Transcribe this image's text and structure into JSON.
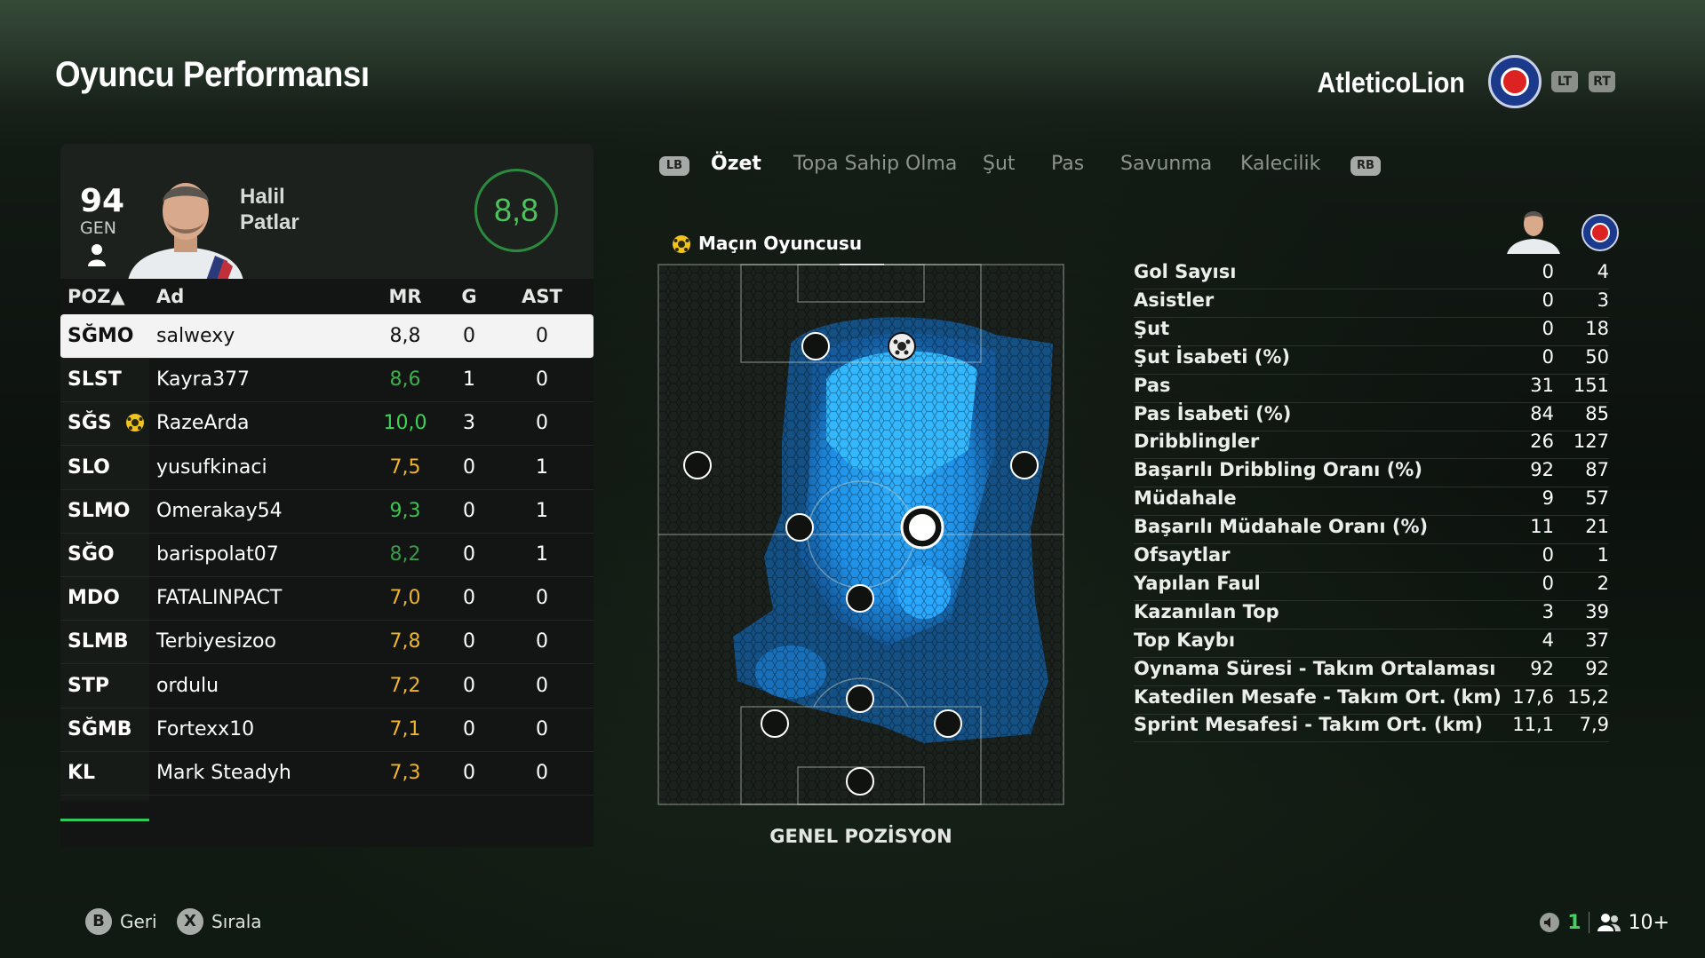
{
  "header": {
    "title": "Oyuncu Performansı",
    "club_name": "AtleticoLion",
    "lt_label": "LT",
    "rt_label": "RT"
  },
  "player_card": {
    "overall": "94",
    "overall_label": "GEN",
    "first_name": "Halil",
    "last_name": "Patlar",
    "match_rating": "8,8"
  },
  "table": {
    "headers": {
      "pos": "POZ▲",
      "name": "Ad",
      "mr": "MR",
      "g": "G",
      "ast": "AST"
    },
    "rows": [
      {
        "pos": "SĞMO",
        "name": "salwexy",
        "mr": "8,8",
        "g": "0",
        "ast": "0",
        "mr_color": "#111111",
        "selected": true,
        "motm": false
      },
      {
        "pos": "SLST",
        "name": "Kayra377",
        "mr": "8,6",
        "g": "1",
        "ast": "0",
        "mr_color": "#3fae4f",
        "selected": false,
        "motm": false
      },
      {
        "pos": "SĞS",
        "name": "RazeArda",
        "mr": "10,0",
        "g": "3",
        "ast": "0",
        "mr_color": "#3fd256",
        "selected": false,
        "motm": true
      },
      {
        "pos": "SLO",
        "name": "yusufkinaci",
        "mr": "7,5",
        "g": "0",
        "ast": "1",
        "mr_color": "#f0b429",
        "selected": false,
        "motm": false
      },
      {
        "pos": "SLMO",
        "name": "Omerakay54",
        "mr": "9,3",
        "g": "0",
        "ast": "1",
        "mr_color": "#3fc252",
        "selected": false,
        "motm": false
      },
      {
        "pos": "SĞO",
        "name": "barispolat07",
        "mr": "8,2",
        "g": "0",
        "ast": "1",
        "mr_color": "#3a9a48",
        "selected": false,
        "motm": false
      },
      {
        "pos": "MDO",
        "name": "FATALINPACT",
        "mr": "7,0",
        "g": "0",
        "ast": "0",
        "mr_color": "#f0b429",
        "selected": false,
        "motm": false
      },
      {
        "pos": "SLMB",
        "name": "Terbiyesizoo",
        "mr": "7,8",
        "g": "0",
        "ast": "0",
        "mr_color": "#f0b429",
        "selected": false,
        "motm": false
      },
      {
        "pos": "STP",
        "name": "ordulu",
        "mr": "7,2",
        "g": "0",
        "ast": "0",
        "mr_color": "#f0b429",
        "selected": false,
        "motm": false
      },
      {
        "pos": "SĞMB",
        "name": "Fortexx10",
        "mr": "7,1",
        "g": "0",
        "ast": "0",
        "mr_color": "#f0b429",
        "selected": false,
        "motm": false
      },
      {
        "pos": "KL",
        "name": "Mark Steadyh",
        "mr": "7,3",
        "g": "0",
        "ast": "0",
        "mr_color": "#f0b429",
        "selected": false,
        "motm": false
      }
    ]
  },
  "tabs": {
    "lb": "LB",
    "rb": "RB",
    "items": [
      "Özet",
      "Topa Sahip Olma",
      "Şut",
      "Pas",
      "Savunma",
      "Kalecilik"
    ],
    "active_index": 0
  },
  "pitch": {
    "motm_label": "Maçın Oyuncusu",
    "caption": "GENEL POZİSYON"
  },
  "stats": {
    "rows": [
      {
        "label": "Gol Sayısı",
        "player": "0",
        "team": "4"
      },
      {
        "label": "Asistler",
        "player": "0",
        "team": "3"
      },
      {
        "label": "Şut",
        "player": "0",
        "team": "18"
      },
      {
        "label": "Şut İsabeti (%)",
        "player": "0",
        "team": "50"
      },
      {
        "label": "Pas",
        "player": "31",
        "team": "151"
      },
      {
        "label": "Pas İsabeti (%)",
        "player": "84",
        "team": "85"
      },
      {
        "label": "Dribblingler",
        "player": "26",
        "team": "127"
      },
      {
        "label": "Başarılı Dribbling Oranı (%)",
        "player": "92",
        "team": "87"
      },
      {
        "label": "Müdahale",
        "player": "9",
        "team": "57"
      },
      {
        "label": "Başarılı Müdahale Oranı (%)",
        "player": "11",
        "team": "21"
      },
      {
        "label": "Ofsaytlar",
        "player": "0",
        "team": "1"
      },
      {
        "label": "Yapılan Faul",
        "player": "0",
        "team": "2"
      },
      {
        "label": "Kazanılan Top",
        "player": "3",
        "team": "39"
      },
      {
        "label": "Top Kaybı",
        "player": "4",
        "team": "37"
      },
      {
        "label": "Oynama Süresi - Takım Ortalaması",
        "player": "92",
        "team": "92"
      },
      {
        "label": "Katedilen Mesafe - Takım Ort. (km)",
        "player": "17,6",
        "team": "15,2"
      },
      {
        "label": "Sprint Mesafesi - Takım Ort. (km)",
        "player": "11,1",
        "team": "7,9"
      }
    ]
  },
  "footer": {
    "back_button": "B",
    "back_label": "Geri",
    "sort_button": "X",
    "sort_label": "Sırala",
    "count": "1",
    "players_label": "10+"
  },
  "colors": {
    "accent_green": "#33c85a",
    "rating_ring": "#2c8a3f",
    "heatmap_blue": "#1e9bff",
    "motm_yellow": "#f2c31b"
  },
  "icons": {
    "motm": "ball-badge-icon",
    "person": "person-icon",
    "crest": "club-crest-icon",
    "mute": "speaker-icon",
    "players": "group-icon"
  }
}
